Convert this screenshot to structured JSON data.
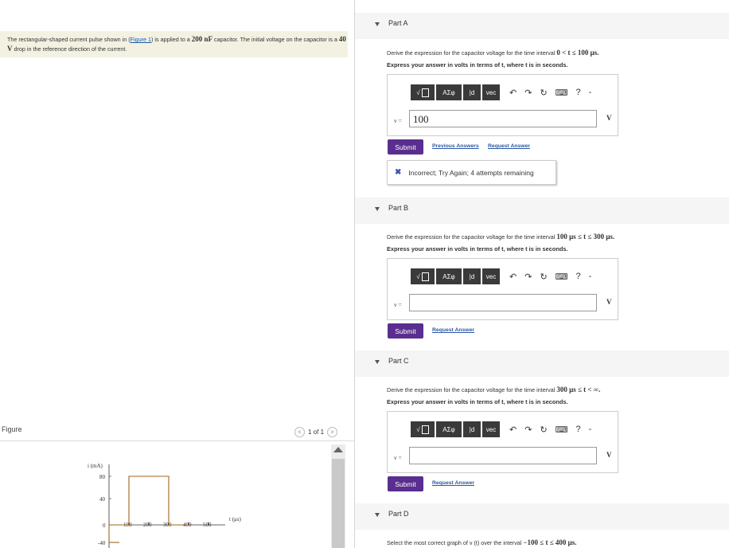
{
  "problem": {
    "text_1": "The rectangular-shaped current pulse shown in (",
    "figure_link": "Figure 1",
    "text_2": ") is applied to a",
    "cap_value": "200 nF",
    "text_3": "capacitor. The initial voltage on the capacitor is a",
    "v0": "40 V",
    "text_4": "drop in the reference direction of the current."
  },
  "figure": {
    "label": "Figure",
    "pager": "1 of 1",
    "prev": "<",
    "next": ">"
  },
  "graph": {
    "ylabel": "i (mA)",
    "xlabel": "t (μs)",
    "y_ticks": [
      "80",
      "40",
      "0",
      "-40"
    ],
    "x_ticks": [
      "100",
      "200",
      "300",
      "400",
      "500"
    ],
    "pulse": {
      "start_us": 100,
      "end_us": 300,
      "amplitude_mA": 80
    }
  },
  "toolbar": {
    "b1": "√",
    "b2": "ΑΣφ",
    "b3": "|d",
    "b4": "vec",
    "undo": "↶",
    "redo": "↷",
    "reset": "↻",
    "keyboard": "⌨",
    "help": "?",
    "dash": "-"
  },
  "partA": {
    "title": "Part A",
    "q_pre": "Derive the expression for the capacitor voltage for the time interval",
    "q_interval": "0 < t ≤ 100 μs.",
    "express": "Express your answer in volts in terms of t, where t is in seconds.",
    "v_label": "v =",
    "answer": "100",
    "unit": "V",
    "submit": "Submit",
    "prev_answers": "Previous Answers",
    "request_answer": "Request Answer",
    "feedback_icon": "✖",
    "feedback": "Incorrect; Try Again; 4 attempts remaining"
  },
  "partB": {
    "title": "Part B",
    "q_pre": "Derive the expression for the capacitor voltage for the time interval",
    "q_interval": "100 μs ≤ t ≤ 300 μs.",
    "express": "Express your answer in volts in terms of t, where t is in seconds.",
    "v_label": "v =",
    "answer": "",
    "unit": "V",
    "submit": "Submit",
    "request_answer": "Request Answer"
  },
  "partC": {
    "title": "Part C",
    "q_pre": "Derive the expression for the capacitor voltage for the time interval",
    "q_interval": "300 μs ≤ t < ∞.",
    "express": "Express your answer in volts in terms of t, where t is in seconds.",
    "v_label": "v =",
    "answer": "",
    "unit": "V",
    "submit": "Submit",
    "request_answer": "Request Answer"
  },
  "partD": {
    "title": "Part D",
    "q_pre": "Select the most correct graph of v (t) over the interval",
    "q_interval": "−100 ≤ t ≤ 400 μs."
  }
}
